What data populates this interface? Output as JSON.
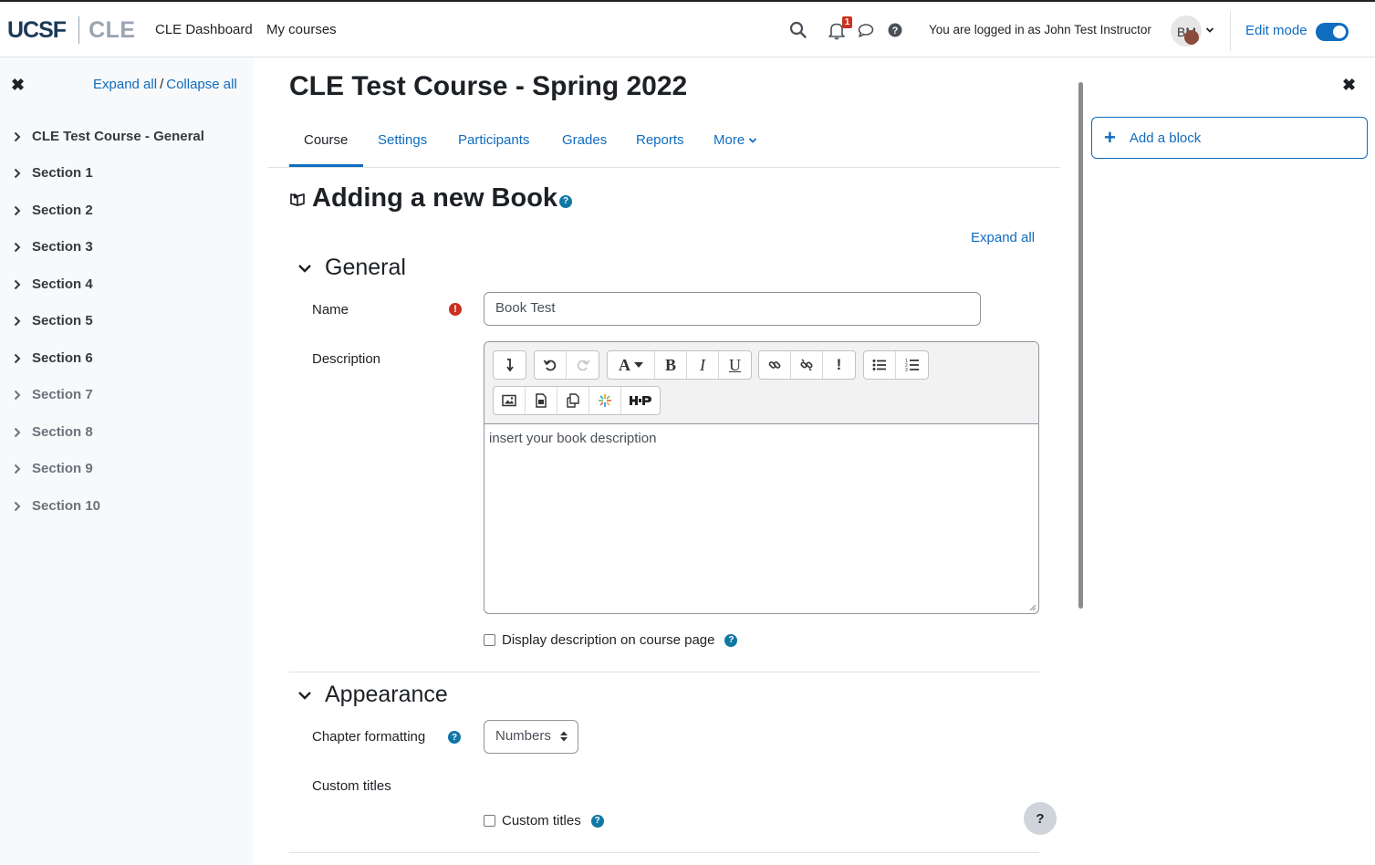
{
  "navbar": {
    "logo_primary": "UCSF",
    "logo_secondary": "CLE",
    "links": [
      "CLE Dashboard",
      "My courses"
    ],
    "notification_count": "1",
    "logged_in_text": "You are logged in as John Test Instructor",
    "avatar_initials": "BM",
    "edit_mode_label": "Edit mode",
    "edit_mode_on": true
  },
  "left_drawer": {
    "expand_all": "Expand all",
    "separator": "/",
    "collapse_all": "Collapse all",
    "sections": [
      "CLE Test Course - General",
      "Section 1",
      "Section 2",
      "Section 3",
      "Section 4",
      "Section 5",
      "Section 6",
      "Section 7",
      "Section 8",
      "Section 9",
      "Section 10"
    ]
  },
  "main": {
    "course_title": "CLE Test Course - Spring 2022",
    "tabs": [
      "Course",
      "Settings",
      "Participants",
      "Grades",
      "Reports",
      "More"
    ],
    "active_tab": "Course",
    "page_heading": "Adding a new Book",
    "expand_all": "Expand all",
    "general": {
      "heading": "General",
      "name_label": "Name",
      "name_value": "Book Test",
      "description_label": "Description",
      "description_value": "insert your book description",
      "display_description_label": "Display description on course page",
      "toolbar_text_buttons": {
        "font": "A",
        "bold": "B",
        "italic": "I",
        "underline": "U",
        "important": "!"
      }
    },
    "appearance": {
      "heading": "Appearance",
      "chapter_formatting_label": "Chapter formatting",
      "chapter_formatting_value": "Numbers",
      "custom_titles_label": "Custom titles",
      "custom_titles_checkbox_label": "Custom titles"
    },
    "floating_help": "?"
  },
  "right_drawer": {
    "add_block_label": "Add a block"
  },
  "colors": {
    "link": "#0f6cbf",
    "required": "#ca3120",
    "drawer_bg": "#f8f9fa"
  }
}
